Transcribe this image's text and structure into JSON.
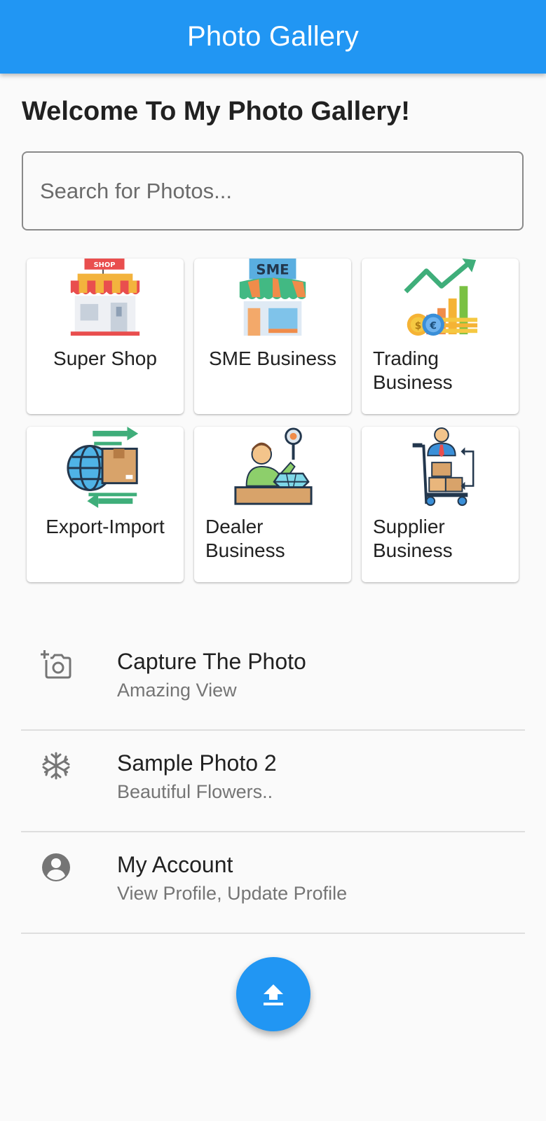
{
  "appbar": {
    "title": "Photo Gallery"
  },
  "welcome": "Welcome To My Photo Gallery!",
  "search": {
    "placeholder": "Search for Photos...",
    "value": ""
  },
  "categories": [
    {
      "label": "Super Shop",
      "icon": "shop-icon"
    },
    {
      "label": "SME Business",
      "icon": "sme-store-icon"
    },
    {
      "label": "Trading Business",
      "icon": "trading-growth-icon"
    },
    {
      "label": "Export-Import",
      "icon": "globe-shipping-icon"
    },
    {
      "label": "Dealer Business",
      "icon": "diamond-dealer-icon"
    },
    {
      "label": "Supplier Business",
      "icon": "supplier-cart-icon"
    }
  ],
  "list": [
    {
      "title": "Capture The Photo",
      "subtitle": "Amazing View",
      "icon": "add-a-photo-icon"
    },
    {
      "title": "Sample Photo 2",
      "subtitle": "Beautiful Flowers..",
      "icon": "snowflake-icon"
    },
    {
      "title": "My Account",
      "subtitle": "View Profile, Update Profile",
      "icon": "account-circle-icon"
    }
  ],
  "fab": {
    "icon": "upload-icon"
  },
  "colors": {
    "primary": "#2196f3",
    "background": "#fafafa",
    "card": "#ffffff",
    "divider": "#dedede",
    "secondary_text": "#757575"
  }
}
